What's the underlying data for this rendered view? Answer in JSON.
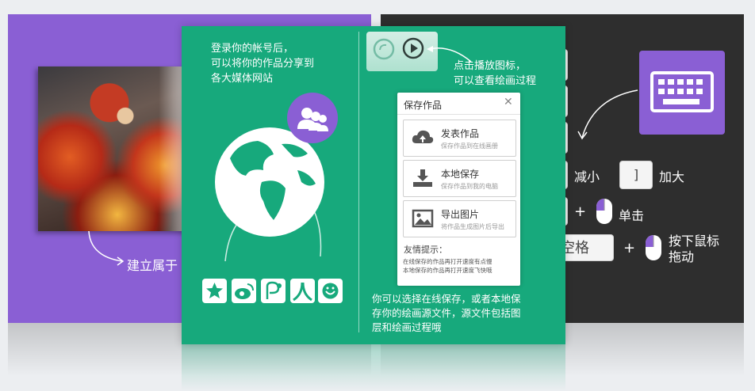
{
  "left_panel": {
    "caption": "建立属于"
  },
  "green_panel": {
    "login_text": [
      "登录你的帐号后，",
      "可以将你的作品分享到",
      "各大媒体网站"
    ],
    "play_hint": [
      "点击播放图标，",
      "可以查看绘画过程"
    ],
    "bottom_text": [
      "你可以选择在线保存，或者本地保",
      "存你的绘画源文件，源文件包括图",
      "层和绘画过程哦"
    ],
    "social_icons": [
      "qzone-icon",
      "weibo-icon",
      "pengyou-icon",
      "renren-icon",
      "kaixin-icon"
    ]
  },
  "dialog": {
    "title": "保存作品",
    "close": "✕",
    "options": [
      {
        "title": "发表作品",
        "subtitle": "保存作品到在线画册",
        "icon": "cloud-upload-icon"
      },
      {
        "title": "本地保存",
        "subtitle": "保存作品到我的电脑",
        "icon": "download-icon"
      },
      {
        "title": "导出图片",
        "subtitle": "将作品生成图片后导出",
        "icon": "image-icon"
      }
    ],
    "tip_title": "友情提示：",
    "tip_lines": [
      "在线保存的作品再打开速度有点慢",
      "本地保存的作品再打开速度飞快哦"
    ]
  },
  "right_panel": {
    "shrink_label": "减小",
    "enlarge_key": "]",
    "enlarge_label": "加大",
    "plus1": "+",
    "click_label": "单击",
    "space_key": "空格",
    "plus2": "+",
    "drag_label": [
      "按下鼠标",
      "拖动"
    ]
  },
  "colors": {
    "purple": "#8a5fd4",
    "green": "#17a97c",
    "dark": "#2e2e2e"
  }
}
